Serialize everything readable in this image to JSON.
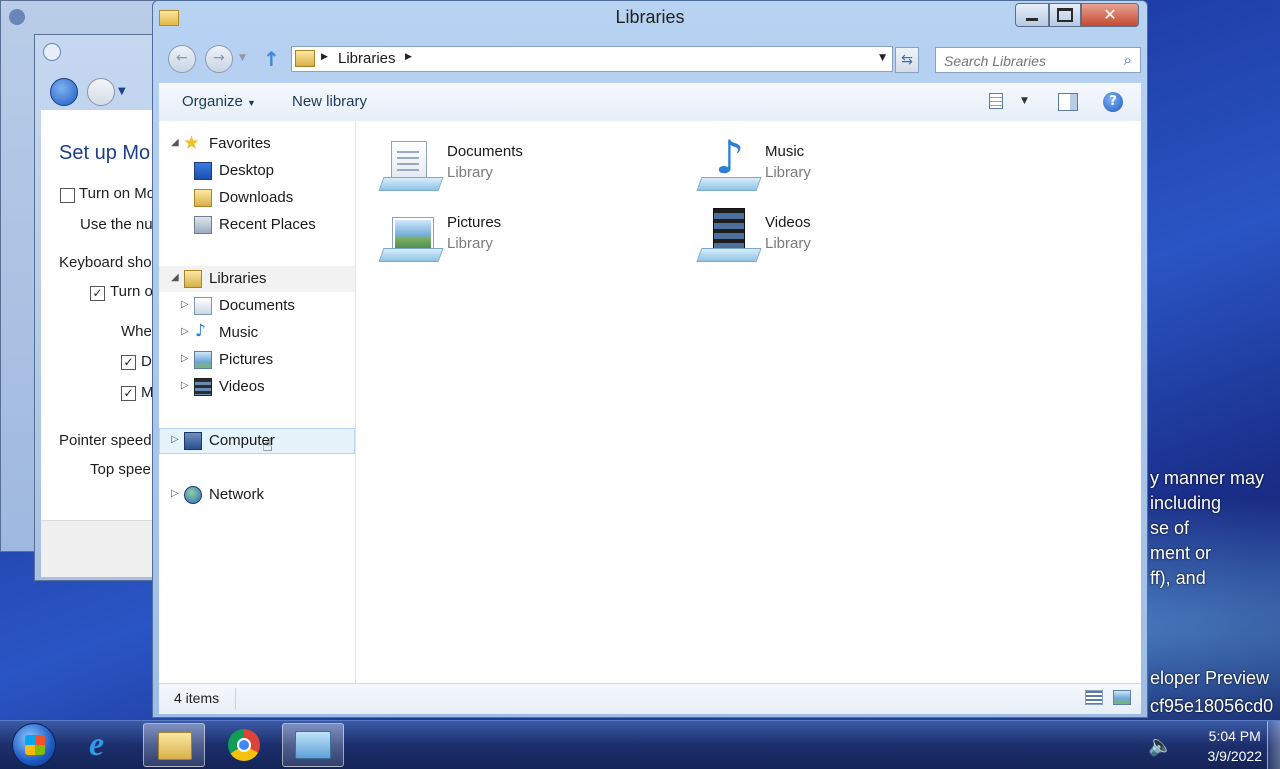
{
  "window": {
    "title": "Libraries",
    "address_path": "Libraries",
    "search_placeholder": "Search Libraries"
  },
  "toolbar": {
    "organize_label": "Organize",
    "new_library_label": "New library"
  },
  "nav": {
    "favorites": "Favorites",
    "desktop": "Desktop",
    "downloads": "Downloads",
    "recent_places": "Recent Places",
    "libraries": "Libraries",
    "documents": "Documents",
    "music": "Music",
    "pictures": "Pictures",
    "videos": "Videos",
    "computer": "Computer",
    "network": "Network"
  },
  "libraries": [
    {
      "name": "Documents",
      "type": "Library"
    },
    {
      "name": "Music",
      "type": "Library"
    },
    {
      "name": "Pictures",
      "type": "Library"
    },
    {
      "name": "Videos",
      "type": "Library"
    }
  ],
  "status": {
    "item_count": "4 items"
  },
  "background_dialog": {
    "title": "Set up Mo",
    "line1": "Turn on Mo",
    "line2": "Use the nu",
    "line3": "Keyboard sho",
    "line4": "Turn o",
    "line5": "Whe",
    "line6": "D",
    "line7": "M",
    "line8": "Pointer speed",
    "line9": "Top spee"
  },
  "desktop_text": {
    "line1": "y manner may",
    "line2": "including",
    "line3": "se of",
    "line4": "ment or",
    "line5": "ff), and",
    "line6": "eloper Preview",
    "line7": "cf95e18056cd0"
  },
  "taskbar": {
    "time": "5:04 PM",
    "date": "3/9/2022"
  },
  "colors": {
    "accent": "#1e395b",
    "desktop": "#1f3fa8",
    "taskbar": "#1c2f6c"
  }
}
